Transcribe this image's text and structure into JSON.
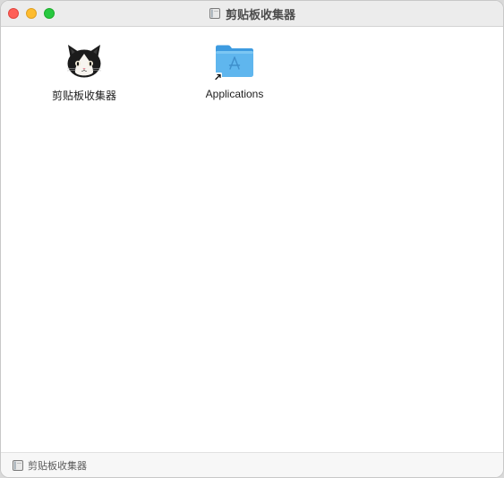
{
  "window": {
    "title": "剪贴板收集器",
    "title_icon": "disk-icon"
  },
  "items": [
    {
      "label": "剪贴板收集器",
      "icon": "cat-app-icon"
    },
    {
      "label": "Applications",
      "icon": "applications-folder-icon"
    }
  ],
  "statusbar": {
    "path_label": "剪贴板收集器",
    "icon": "disk-icon"
  },
  "colors": {
    "close": "#fe5f57",
    "minimize": "#febc2e",
    "maximize": "#28c840",
    "folder": "#5fb6ee"
  }
}
